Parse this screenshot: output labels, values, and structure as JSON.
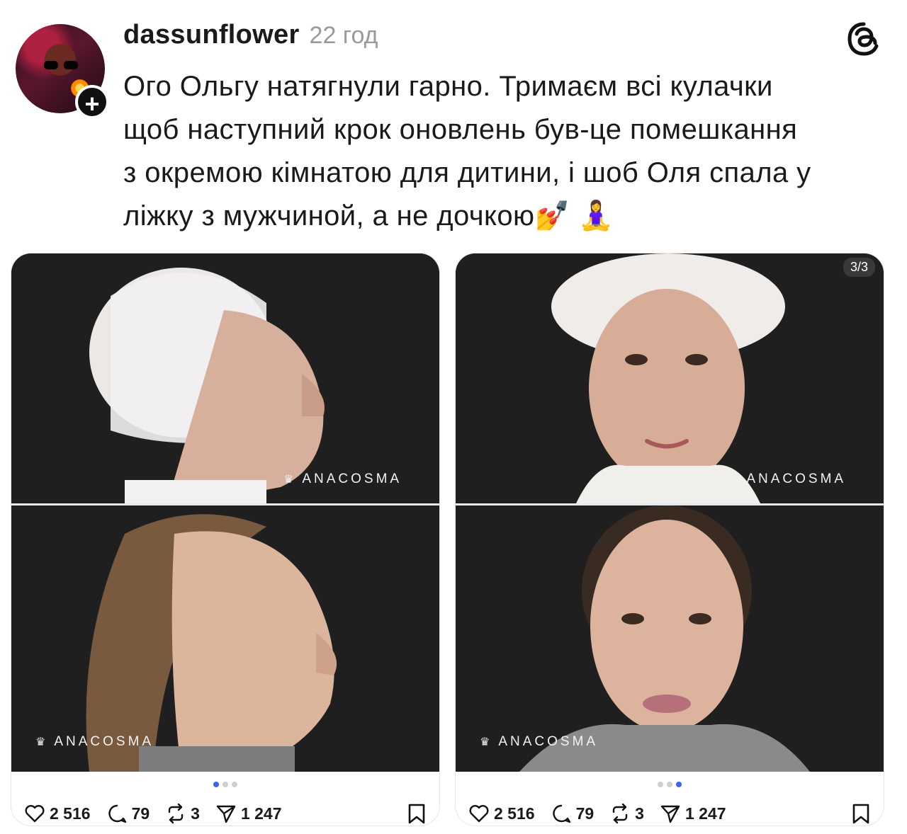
{
  "post": {
    "username": "dassunflower",
    "time": "22 год",
    "text": "Ого Ольгу натягнули гарно. Тримаєм всі кулачки\nщоб наступний крок оновлень був-це помешкання\nз окремою кімнатою для дитини, і шоб Оля спала у\nліжку з мужчиной, а не дочкою💅 🧘‍♀️",
    "follow_badge": "+"
  },
  "cards": [
    {
      "brand_top": "ANACOSMA",
      "brand_bottom": "ANACOSMA",
      "page_indicator": "",
      "likes": "2 516",
      "comments": "79",
      "reposts": "3",
      "shares": "1 247"
    },
    {
      "brand_top": "ANACOSMA",
      "brand_bottom": "ANACOSMA",
      "page_indicator": "3/3",
      "likes": "2 516",
      "comments": "79",
      "reposts": "3",
      "shares": "1 247"
    }
  ],
  "colors": {
    "panel_bg": "#1f1f1f",
    "dot_active": "#3b64f0",
    "dot_inactive": "#cfcfcf",
    "time_gray": "#9a9a9a"
  },
  "icons": [
    "threads-logo-icon",
    "heart-icon",
    "comment-icon",
    "repost-icon",
    "share-icon",
    "bookmark-icon",
    "crown-icon"
  ]
}
